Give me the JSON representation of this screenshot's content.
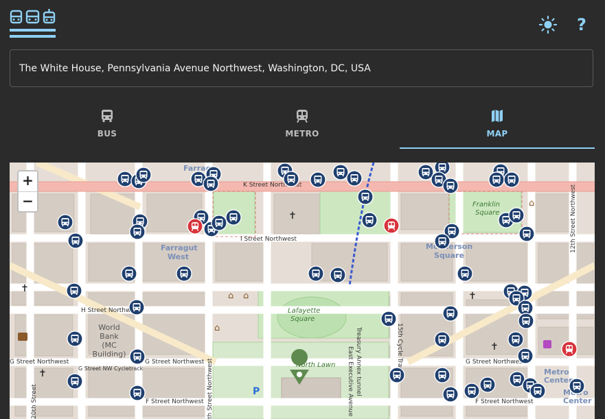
{
  "header": {
    "logo_icon": "transit-logo-icon",
    "theme_icon": "sun-icon",
    "help_label": "?"
  },
  "search": {
    "value": "The White House, Pennsylvania Avenue Northwest, Washington, DC, USA"
  },
  "tabs": [
    {
      "label": "BUS",
      "icon": "bus-icon",
      "active": false
    },
    {
      "label": "METRO",
      "icon": "train-icon",
      "active": false
    },
    {
      "label": "MAP",
      "icon": "map-icon",
      "active": true
    }
  ],
  "map": {
    "zoom_in": "+",
    "zoom_out": "−",
    "labels": {
      "k_street": "K Street Northwest",
      "i_street": "I Street Northwest",
      "h_street": "H Street Northwest",
      "g_street_w": "G Street Northwest",
      "g_street_sw": "G Street Northwest",
      "g_street_e": "G Street Northwest",
      "f_street_w": "F Street Northwest",
      "f_street_e": "F Street Northwest",
      "g_cycletrack": "G Street NW Cycletrack",
      "farragut": "Farrag",
      "farragut_west_1": "Farragut",
      "farragut_west_2": "West",
      "mcpherson_1": "McPherson",
      "mcpherson_2": "Square",
      "franklin_1": "Franklin",
      "franklin_2": "Square",
      "lafayette_1": "Lafayette",
      "lafayette_2": "Square",
      "world_bank_1": "World",
      "world_bank_2": "Bank",
      "world_bank_3": "(MC",
      "world_bank_4": "Building)",
      "north_lawn": "North Lawn",
      "metro_center_1": "Metro",
      "metro_center_2": "Center",
      "metro_center_3": "Metro",
      "metro_center_4": "Center",
      "twelfth_street": "12th Street Northwest",
      "twentieth_street": "20th Street",
      "seventeenth_street": "th Street Northwest",
      "fifteenth_street": "15th Cycle Track",
      "treasury_tunnel": "Treasury Annex tunnel",
      "east_exec": "East Executive Avenue",
      "parking": "P"
    },
    "colors": {
      "bus_marker": "#1f3f6e",
      "metro_marker": "#d7333b",
      "road_major": "#f4b8b0",
      "park": "#c9e7bd"
    }
  }
}
